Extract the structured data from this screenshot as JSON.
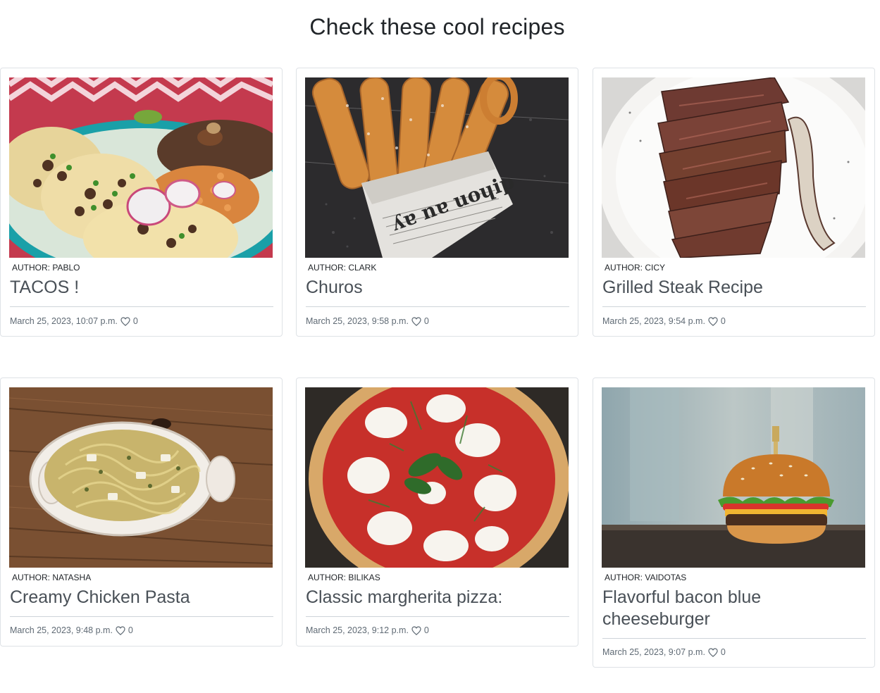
{
  "page": {
    "title": "Check these cool recipes"
  },
  "recipes": [
    {
      "author": "Author: Pablo",
      "title": "TACOS !",
      "date": "March 25, 2023, 10:07 p.m.",
      "likes": "0",
      "image": "tacos plate"
    },
    {
      "author": "Author: Clark",
      "title": "Churos",
      "date": "March 25, 2023, 9:58 p.m.",
      "likes": "0",
      "image": "churros in newspaper"
    },
    {
      "author": "Author: Cicy",
      "title": "Grilled Steak Recipe",
      "date": "March 25, 2023, 9:54 p.m.",
      "likes": "0",
      "image": "sliced grilled steak"
    },
    {
      "author": "Author: Natasha",
      "title": "Creamy Chicken Pasta",
      "date": "March 25, 2023, 9:48 p.m.",
      "likes": "0",
      "image": "pasta dish on wood"
    },
    {
      "author": "Author: Bilikas",
      "title": "Classic margherita pizza:",
      "date": "March 25, 2023, 9:12 p.m.",
      "likes": "0",
      "image": "margherita pizza"
    },
    {
      "author": "Author: Vaidotas",
      "title": "Flavorful bacon blue cheeseburger",
      "date": "March 25, 2023, 9:07 p.m.",
      "likes": "0",
      "image": "cheeseburger"
    }
  ],
  "colors": {
    "title_text": "#495057",
    "meta_text": "#5f6a74",
    "border": "#dee2e6"
  },
  "icons": {
    "like": "heart-outline-icon"
  }
}
